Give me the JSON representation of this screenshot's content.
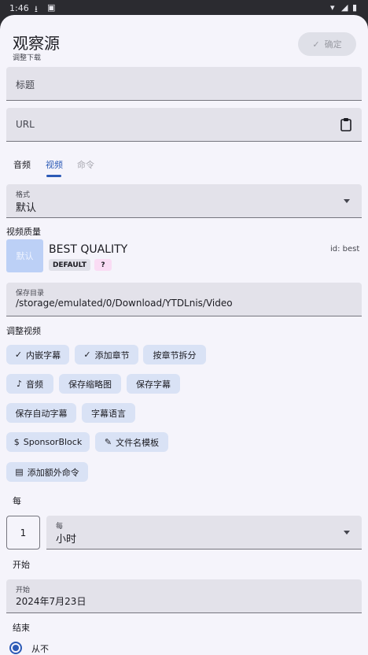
{
  "status_bar": {
    "time": "1:46"
  },
  "header": {
    "title": "观察源",
    "subtitle": "调整下载",
    "confirm_label": "确定"
  },
  "fields": {
    "title_placeholder": "标题",
    "url_placeholder": "URL"
  },
  "tabs": [
    {
      "label": "音频"
    },
    {
      "label": "视频"
    },
    {
      "label": "命令"
    }
  ],
  "format": {
    "label": "格式",
    "value": "默认"
  },
  "video_quality": {
    "label": "视频质量",
    "thumb_text": "默认",
    "name": "BEST QUALITY",
    "id_text": "id: best",
    "badge_default": "DEFAULT",
    "badge_q": "?"
  },
  "save_dir": {
    "label": "保存目录",
    "value": "/storage/emulated/0/Download/YTDLnis/Video"
  },
  "adjust": {
    "label": "调整视频",
    "chips": {
      "embed_subs": "内嵌字幕",
      "add_chapters": "添加章节",
      "split_chapters": "按章节拆分",
      "audio": "音频",
      "save_thumbnail": "保存缩略图",
      "save_subs": "保存字幕",
      "save_auto_subs": "保存自动字幕",
      "sub_lang": "字幕语言",
      "sponsorblock": "SponsorBlock",
      "filename_template": "文件名模板",
      "extra_commands": "添加额外命令"
    }
  },
  "every": {
    "label": "每",
    "number": "1",
    "unit_label": "每",
    "unit_value": "小时"
  },
  "start": {
    "label": "开始",
    "field_label": "开始",
    "value": "2024年7月23日"
  },
  "end": {
    "label": "结束",
    "option_never": "从不"
  },
  "colors": {
    "accent": "#2c5ab6",
    "chip_bg": "#d9e2f5",
    "field_bg": "#e3e2ea",
    "sheet_bg": "#f5f4fb"
  }
}
